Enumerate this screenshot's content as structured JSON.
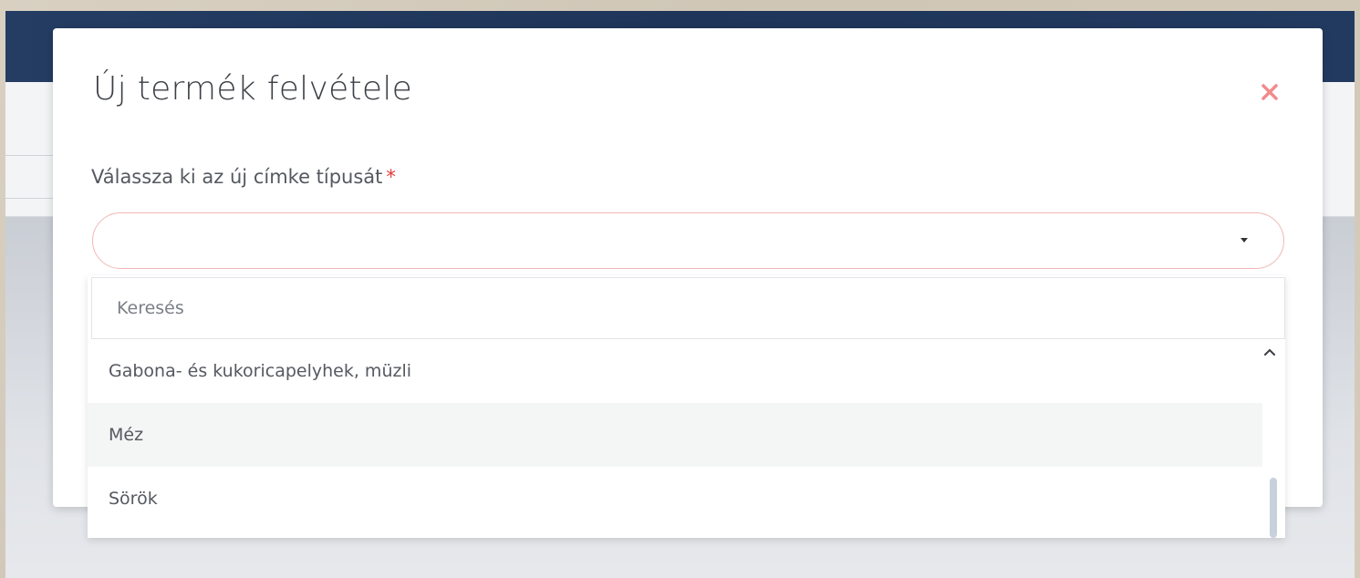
{
  "modal": {
    "title": "Új termék felvétele",
    "close_icon": "close-x-icon",
    "close_color": "#f28b8b"
  },
  "field": {
    "label": "Válassza ki az új címke típusát",
    "required_marker": "*",
    "selected_value": "",
    "caret_icon": "caret-down-icon"
  },
  "dropdown": {
    "search_placeholder": "Keresés",
    "options": [
      {
        "label": "Gabona- és kukoricapelyhek, müzli"
      },
      {
        "label": "Méz"
      },
      {
        "label": "Sörök"
      }
    ],
    "hovered_index": 1,
    "scroll_up_icon": "chevron-up-icon"
  },
  "colors": {
    "header_bg": "#1f3559",
    "select_border": "#f2b7b7",
    "required": "#e23b3b",
    "hover_bg": "#f4f5f5"
  }
}
